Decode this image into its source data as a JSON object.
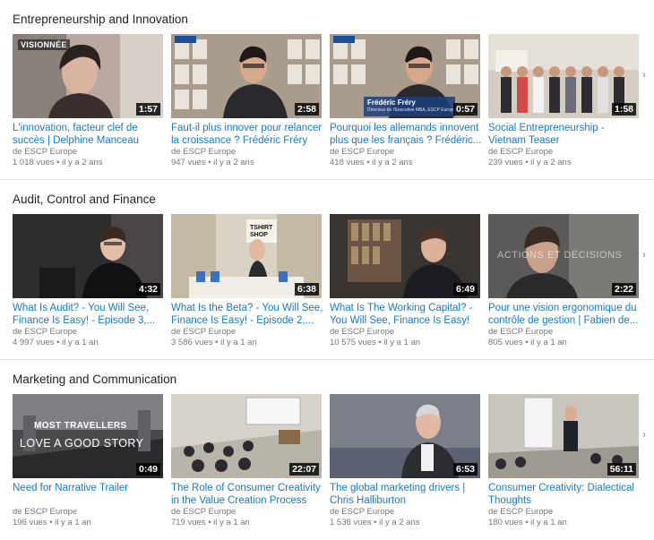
{
  "shelves": [
    {
      "title": "Entrepreneurship and Innovation",
      "videos": [
        {
          "title": "L'innovation, facteur clef de succès | Delphine Manceau",
          "channel": "de ESCP Europe",
          "meta": "1 018 vues • il y a 2 ans",
          "duration": "1:57",
          "watched_label": "VISIONNÉE"
        },
        {
          "title": "Faut-il plus innover pour relancer la croissance ? Frédéric Fréry",
          "channel": "de ESCP Europe",
          "meta": "947 vues • il y a 2 ans",
          "duration": "2:58"
        },
        {
          "title": "Pourquoi les allemands innovent plus que les français ? Frédéric...",
          "channel": "de ESCP Europe",
          "meta": "418 vues • il y a 2 ans",
          "duration": "0:57",
          "overlay_name": "Frédéric Fréry",
          "overlay_sub": "Directeur de l'Executive MBA, ESCP Europe"
        },
        {
          "title": "Social Entrepreneurship - Vietnam Teaser",
          "channel": "de ESCP Europe",
          "meta": "239 vues • il y a 2 ans",
          "duration": "1:58"
        }
      ]
    },
    {
      "title": "Audit, Control and Finance",
      "videos": [
        {
          "title": "What Is Audit? - You Will See, Finance Is Easy! - Episode 3,...",
          "channel": "de ESCP Europe",
          "meta": "4 997 vues • il y a 1 an",
          "duration": "4:32"
        },
        {
          "title": "What Is the Beta? - You Will See, Finance Is Easy! - Episode 2,...",
          "channel": "de ESCP Europe",
          "meta": "3 586 vues • il y a 1 an",
          "duration": "6:38",
          "overlay_name": "TSHIRT SHOP"
        },
        {
          "title": "What Is The Working Capital? - You Will See, Finance Is Easy! -...",
          "channel": "de ESCP Europe",
          "meta": "10 575 vues • il y a 1 an",
          "duration": "6:49"
        },
        {
          "title": "Pour une vision ergonomique du contrôle de gestion | Fabien de...",
          "channel": "de ESCP Europe",
          "meta": "805 vues • il y a 1 an",
          "duration": "2:22",
          "overlay_name": "ACTIONS ET DÉCISIONS"
        }
      ]
    },
    {
      "title": "Marketing and Communication",
      "videos": [
        {
          "title": "Need for Narrative Trailer",
          "channel": "de ESCP Europe",
          "meta": "196 vues • il y a 1 an",
          "duration": "0:49",
          "overlay_name": "MOST TRAVELLERS",
          "overlay_sub": "LOVE A GOOD STORY"
        },
        {
          "title": "The Role of Consumer Creativity in the Value Creation Process",
          "channel": "de ESCP Europe",
          "meta": "719 vues • il y a 1 an",
          "duration": "22:07"
        },
        {
          "title": "The global marketing drivers | Chris Halliburton",
          "channel": "de ESCP Europe",
          "meta": "1 538 vues • il y a 2 ans",
          "duration": "6:53"
        },
        {
          "title": "Consumer Creativity: Dialectical Thoughts",
          "channel": "de ESCP Europe",
          "meta": "180 vues • il y a 1 an",
          "duration": "56:11"
        }
      ]
    }
  ],
  "arrow_glyph": "›"
}
